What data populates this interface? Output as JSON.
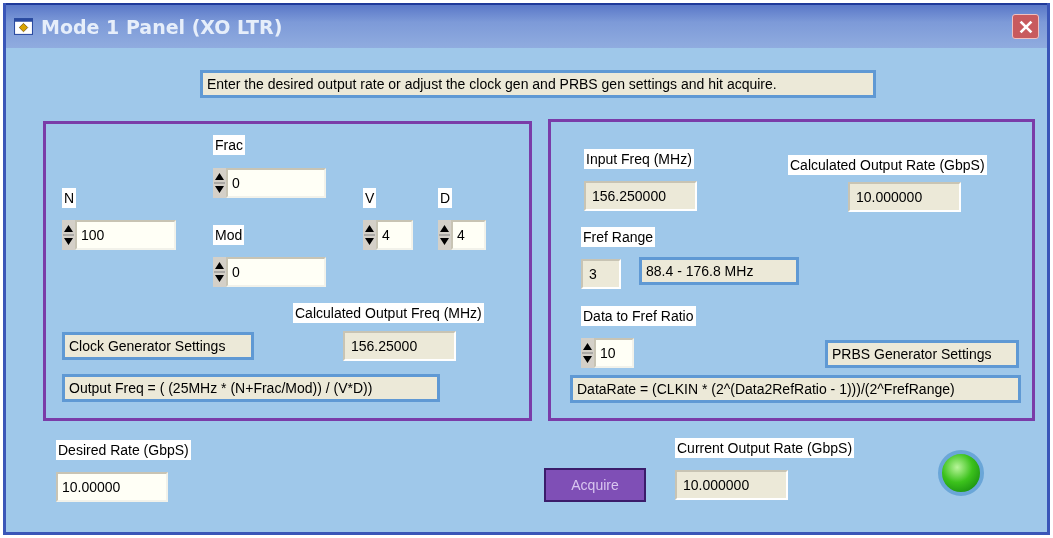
{
  "window": {
    "title": "Mode 1 Panel (XO LTR)"
  },
  "instruction": "Enter the desired output rate or adjust the clock gen and PRBS gen settings and hit acquire.",
  "clock_panel": {
    "frac": {
      "label": "Frac",
      "value": "0"
    },
    "n": {
      "label": "N",
      "value": "100"
    },
    "mod": {
      "label": "Mod",
      "value": "0"
    },
    "v": {
      "label": "V",
      "value": "4"
    },
    "d": {
      "label": "D",
      "value": "4"
    },
    "calculated_output_freq": {
      "label": "Calculated Output Freq (MHz)",
      "value": "156.25000"
    },
    "title": "Clock Generator Settings",
    "formula": "Output Freq = ( (25MHz * (N+Frac/Mod)) / (V*D))"
  },
  "prbs_panel": {
    "input_freq": {
      "label": "Input Freq (MHz)",
      "value": "156.250000"
    },
    "calculated_output_rate": {
      "label": "Calculated Output Rate (GbpS)",
      "value": "10.000000"
    },
    "fref_range": {
      "label": "Fref Range",
      "value": "3",
      "range": "88.4 - 176.8 MHz"
    },
    "data_to_fref_ratio": {
      "label": "Data to Fref Ratio",
      "value": "10"
    },
    "title": "PRBS Generator Settings",
    "formula": "DataRate = (CLKIN * (2^(Data2RefRatio - 1)))/(2^FrefRange)"
  },
  "desired_rate": {
    "label": "Desired Rate (GbpS)",
    "value": "10.00000"
  },
  "acquire_button": "Acquire",
  "current_output_rate": {
    "label": "Current Output Rate (GbpS)",
    "value": "10.000000"
  },
  "status_led": {
    "on": true
  }
}
